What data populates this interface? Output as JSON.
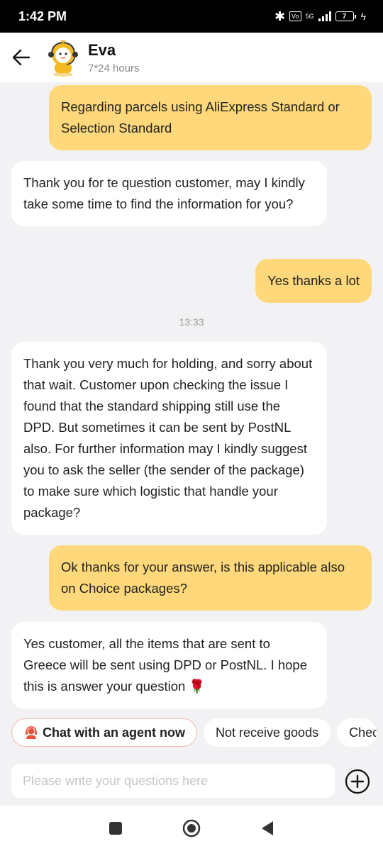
{
  "status_bar": {
    "time": "1:42 PM",
    "network": "5G",
    "battery": "7"
  },
  "header": {
    "name": "Eva",
    "availability": "7*24 hours"
  },
  "messages": [
    {
      "from": "user",
      "text": "Regarding parcels using AliExpress Standard or Selection Standard"
    },
    {
      "from": "agent",
      "text": "Thank you for te question customer, may I kindly take some time to find the information for you?"
    },
    {
      "from": "user",
      "text": "Yes thanks a lot"
    },
    {
      "from": "agent",
      "text": "Thank you very much for holding, and sorry about that wait. Customer upon checking the issue I found that the standard shipping still use the DPD. But sometimes it can be sent by PostNL also. For further information may I kindly suggest you to ask the seller (the sender of the package) to make sure which logistic that handle your package?"
    },
    {
      "from": "user",
      "text": "Ok thanks for your answer, is this applicable also on Choice packages?"
    },
    {
      "from": "agent",
      "text": "Yes customer, all the items that are sent to Greece will be sent using DPD or PostNL. I hope this is answer your question 🌹"
    }
  ],
  "timestamp": "13:33",
  "quick_replies": [
    {
      "label": "Chat with an agent now",
      "icon": "agent-headset-icon"
    },
    {
      "label": "Not receive goods"
    },
    {
      "label": "Check"
    }
  ],
  "composer": {
    "placeholder": "Please write your questions here",
    "value": ""
  },
  "colors": {
    "user_bubble": "#fed87a",
    "agent_bubble": "#ffffff",
    "background": "#f2f2f4",
    "accent": "#e8553a"
  }
}
